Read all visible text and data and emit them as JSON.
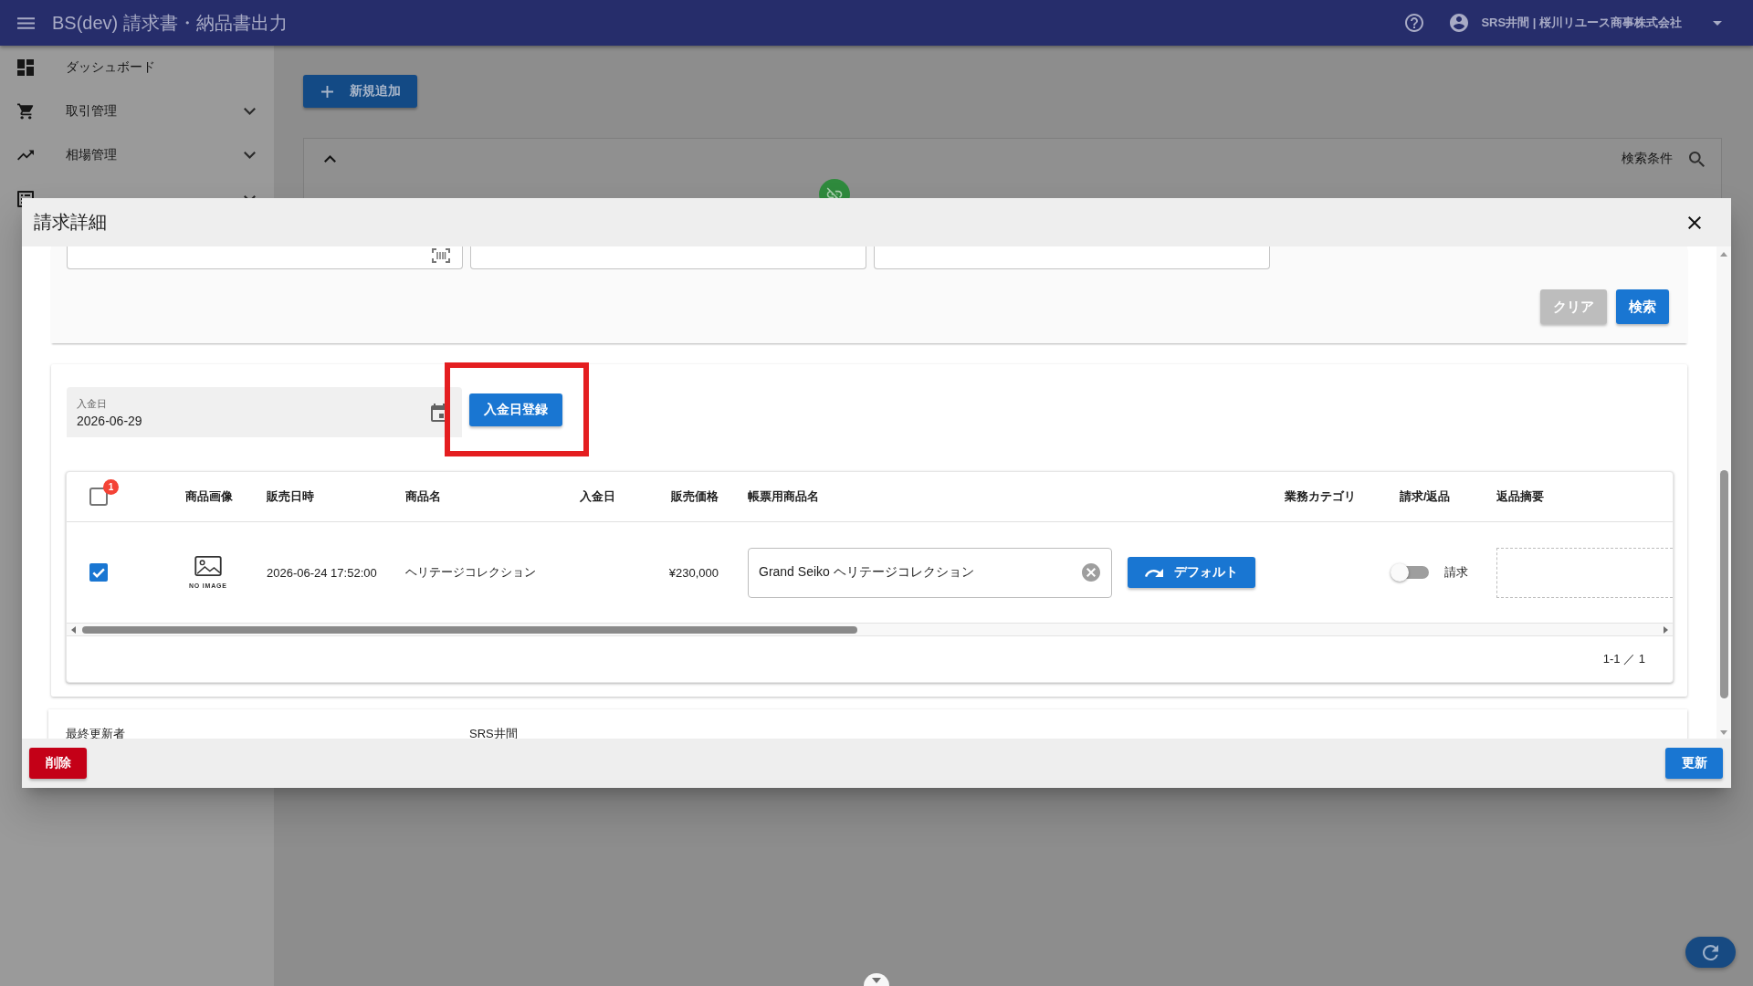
{
  "app_bar": {
    "title": "BS(dev) 請求書・納品書出力",
    "user": "SRS井間 | 桜川リユース商事株式会社"
  },
  "sidebar": {
    "items": [
      {
        "label": "ダッシュボード",
        "kind": "link"
      },
      {
        "label": "取引管理",
        "kind": "group",
        "expanded": false
      },
      {
        "label": "相場管理",
        "kind": "group",
        "expanded": false
      },
      {
        "kind": "group",
        "expanded": false
      }
    ]
  },
  "page": {
    "add_button": "新規追加",
    "search_panel": {
      "expanded": true,
      "title": "検索条件"
    }
  },
  "dialog": {
    "title": "請求詳細",
    "search_form": {
      "fields": [
        {
          "kind": "scan"
        },
        {
          "kind": "text"
        },
        {
          "kind": "text"
        }
      ],
      "buttons": [
        {
          "label": "クリア",
          "kind": "secondary"
        },
        {
          "label": "検索",
          "kind": "primary"
        }
      ]
    },
    "payment": {
      "label": "入金日",
      "value": "2026-06-29",
      "button": {
        "label": "入金日登録",
        "highlighted": true
      }
    },
    "table": {
      "select_all": {
        "checked": false,
        "badge": "1"
      },
      "columns": [
        "商品画像",
        "販売日時",
        "商品名",
        "入金日",
        "販売価格",
        "帳票用商品名",
        "業務カテゴリ",
        "請求/返品",
        "返品摘要"
      ],
      "rows": [
        {
          "checked": true,
          "image_label": "NO IMAGE",
          "sold_at": "2026-06-24 17:52:00",
          "product": "ヘリテージコレクション",
          "price": "¥230,000",
          "invoice_name": "Grand Seiko ヘリテージコレクション",
          "default_button": "デフォルト",
          "billing": {
            "on": false,
            "label": "請求"
          }
        }
      ],
      "pagination": "1-1 ／ 1"
    },
    "meta": [
      {
        "label": "最終更新者",
        "value": "SRS井間"
      }
    ],
    "footer": {
      "delete": "削除",
      "update": "更新"
    }
  }
}
